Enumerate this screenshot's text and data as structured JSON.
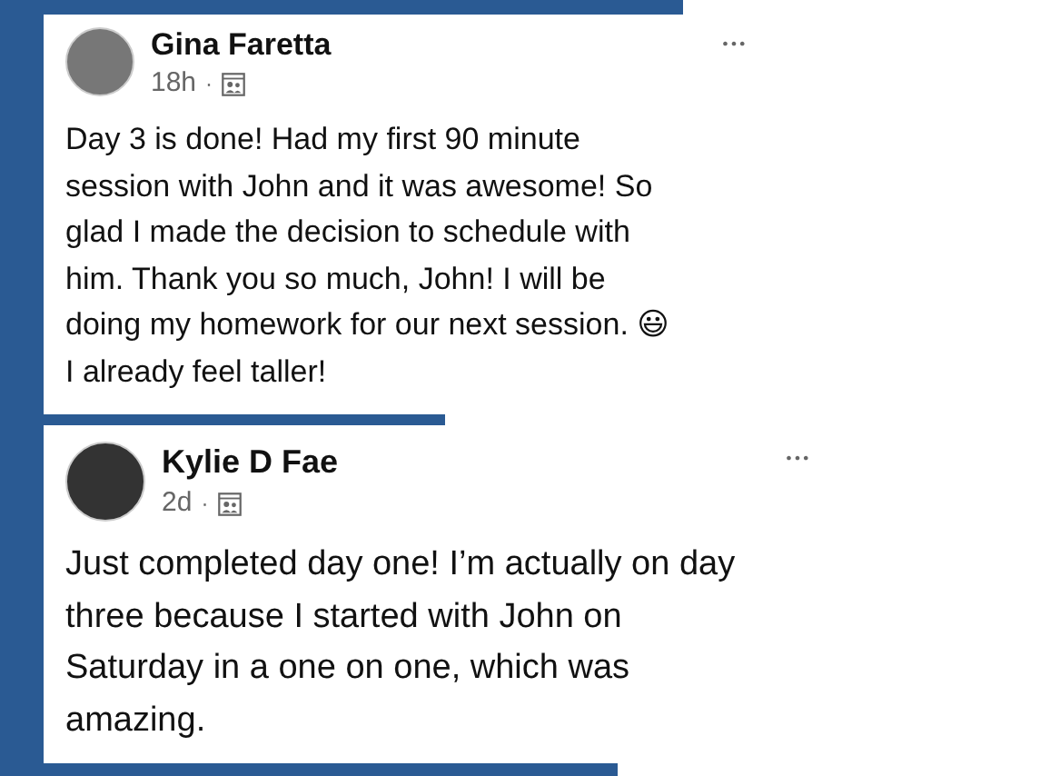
{
  "posts": [
    {
      "author": "Gina Faretta",
      "time": "18h",
      "separator": "·",
      "more": "•••",
      "text": "Day 3 is done! Had my first 90 minute\nsession with John and it was awesome! So\nglad I made the decision to schedule with\nhim. Thank you so much, John! I will be\ndoing my homework for our next session. 😃\nI already feel taller!"
    },
    {
      "author": "Kylie D Fae",
      "time": "2d",
      "separator": "·",
      "more": "•••",
      "text": "Just completed day one! I’m actually on day\nthree because I started with John on\nSaturday in a one on one, which was\namazing."
    }
  ]
}
